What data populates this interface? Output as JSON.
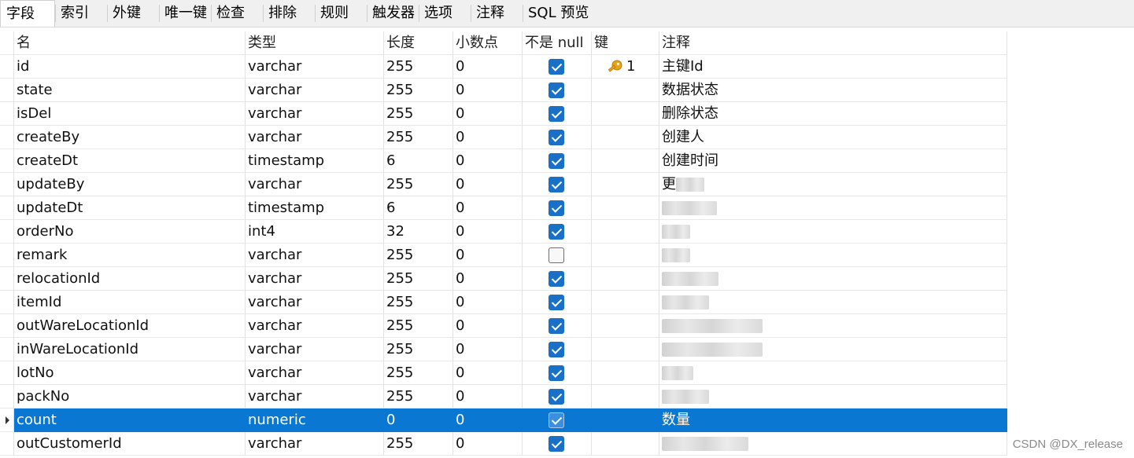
{
  "tabs": [
    "字段",
    "索引",
    "外键",
    "唯一键",
    "检查",
    "排除",
    "规则",
    "触发器",
    "选项",
    "注释",
    "SQL 预览"
  ],
  "columns": [
    "名",
    "类型",
    "长度",
    "小数点",
    "不是 null",
    "键",
    "注释"
  ],
  "rows": [
    {
      "name": "id",
      "type": "varchar",
      "length": "255",
      "decimal": "0",
      "not_null": true,
      "key": "1",
      "comment": "主键Id"
    },
    {
      "name": "state",
      "type": "varchar",
      "length": "255",
      "decimal": "0",
      "not_null": true,
      "key": "",
      "comment": "数据状态"
    },
    {
      "name": "isDel",
      "type": "varchar",
      "length": "255",
      "decimal": "0",
      "not_null": true,
      "key": "",
      "comment": "删除状态"
    },
    {
      "name": "createBy",
      "type": "varchar",
      "length": "255",
      "decimal": "0",
      "not_null": true,
      "key": "",
      "comment": "创建人"
    },
    {
      "name": "createDt",
      "type": "timestamp",
      "length": "6",
      "decimal": "0",
      "not_null": true,
      "key": "",
      "comment": "创建时间"
    },
    {
      "name": "updateBy",
      "type": "varchar",
      "length": "255",
      "decimal": "0",
      "not_null": true,
      "key": "",
      "comment": "更"
    },
    {
      "name": "updateDt",
      "type": "timestamp",
      "length": "6",
      "decimal": "0",
      "not_null": true,
      "key": "",
      "comment": ""
    },
    {
      "name": "orderNo",
      "type": "int4",
      "length": "32",
      "decimal": "0",
      "not_null": true,
      "key": "",
      "comment": ""
    },
    {
      "name": "remark",
      "type": "varchar",
      "length": "255",
      "decimal": "0",
      "not_null": false,
      "key": "",
      "comment": ""
    },
    {
      "name": "relocationId",
      "type": "varchar",
      "length": "255",
      "decimal": "0",
      "not_null": true,
      "key": "",
      "comment": ""
    },
    {
      "name": "itemId",
      "type": "varchar",
      "length": "255",
      "decimal": "0",
      "not_null": true,
      "key": "",
      "comment": ""
    },
    {
      "name": "outWareLocationId",
      "type": "varchar",
      "length": "255",
      "decimal": "0",
      "not_null": true,
      "key": "",
      "comment": ""
    },
    {
      "name": "inWareLocationId",
      "type": "varchar",
      "length": "255",
      "decimal": "0",
      "not_null": true,
      "key": "",
      "comment": ""
    },
    {
      "name": "lotNo",
      "type": "varchar",
      "length": "255",
      "decimal": "0",
      "not_null": true,
      "key": "",
      "comment": ""
    },
    {
      "name": "packNo",
      "type": "varchar",
      "length": "255",
      "decimal": "0",
      "not_null": true,
      "key": "",
      "comment": ""
    },
    {
      "name": "count",
      "type": "numeric",
      "length": "0",
      "decimal": "0",
      "not_null": true,
      "key": "",
      "comment": "数量",
      "selected": true
    },
    {
      "name": "outCustomerId",
      "type": "varchar",
      "length": "255",
      "decimal": "0",
      "not_null": true,
      "key": "",
      "comment": ""
    }
  ],
  "watermark": "CSDN @DX_release",
  "colors": {
    "selection": "#0a78d2",
    "checkbox": "#1a6fc7",
    "key": "#e8a317"
  }
}
